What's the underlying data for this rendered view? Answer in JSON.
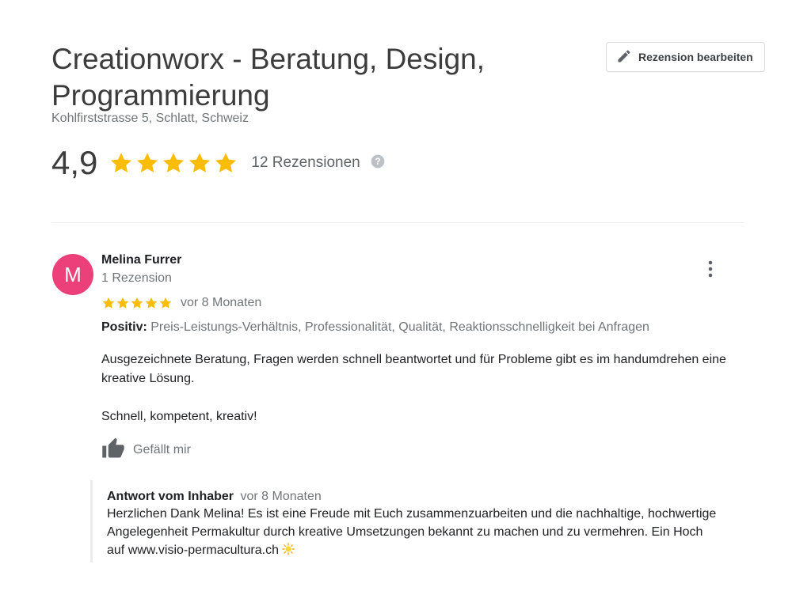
{
  "business": {
    "name": "Creationworx - Beratung, Design, Programmierung",
    "address": "Kohlfirststrasse 5, Schlatt, Schweiz",
    "rating": "4,9",
    "stars": 5,
    "review_count": "12 Rezensionen",
    "edit_review_label": "Rezension bearbeiten"
  },
  "review": {
    "avatar_initial": "M",
    "reviewer_name": "Melina Furrer",
    "reviewer_review_count": "1 Rezension",
    "stars": 5,
    "date": "vor 8 Monaten",
    "positive_label": "Positiv:",
    "positive_text": "Preis-Leistungs-Verhältnis, Professionalität, Qualität, Reaktionsschnelligkeit bei Anfragen",
    "text_paragraphs": [
      "Ausgezeichnete Beratung, Fragen werden schnell beantwortet und für Probleme gibt es im handumdrehen eine kreative Lösung.",
      "Schnell, kompetent, kreativ!"
    ],
    "like_label": "Gefällt mir"
  },
  "owner_reply": {
    "title": "Antwort vom Inhaber",
    "date": "vor 8 Monaten",
    "text": "Herzlichen Dank Melina! Es ist eine Freude mit Euch zusammenzuarbeiten und die nachhaltige, hochwertige Angelegenheit Permakultur durch kreative Umsetzungen bekannt zu machen und zu vermehren. Ein Hoch auf www.visio-permacultura.ch",
    "emoji": "sun-icon"
  },
  "colors": {
    "star": "#fbbc04",
    "avatar": "#ec407a",
    "divider": "#ebebeb",
    "secondary_text": "#70757a"
  },
  "icons": [
    "pencil-icon",
    "star-icon",
    "help-icon",
    "more-vert-icon",
    "thumb-up-icon",
    "sun-icon"
  ]
}
